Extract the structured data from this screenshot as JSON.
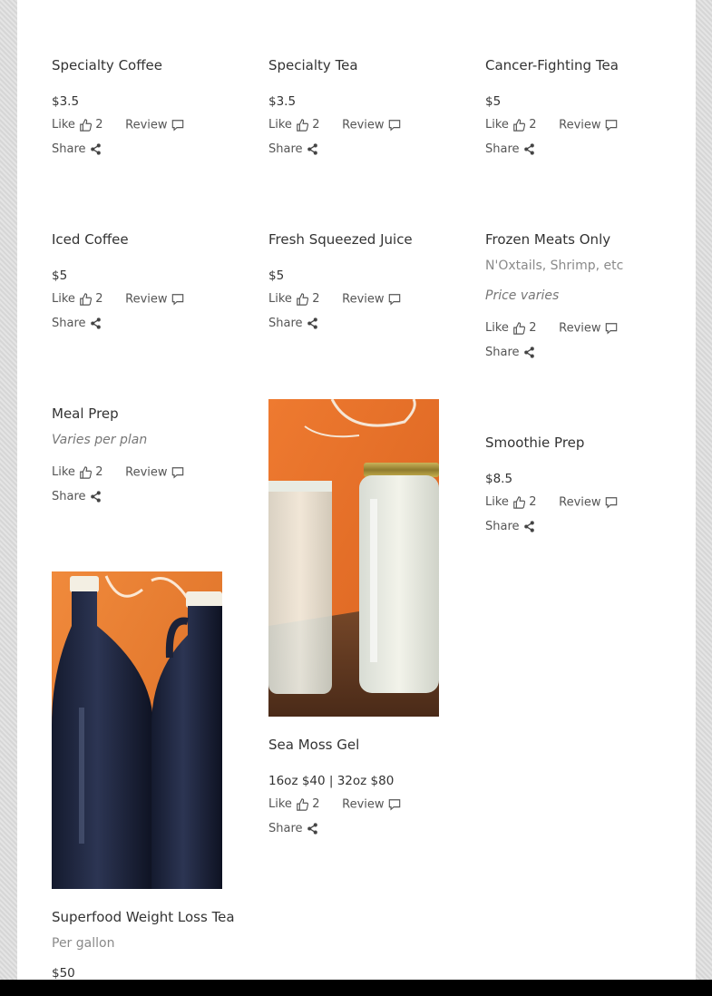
{
  "items": [
    {
      "title": "Specialty Coffee",
      "price": "$3.5",
      "like_label": "Like",
      "likes": "2",
      "review_label": "Review",
      "share_label": "Share"
    },
    {
      "title": "Specialty Tea",
      "price": "$3.5",
      "like_label": "Like",
      "likes": "2",
      "review_label": "Review",
      "share_label": "Share"
    },
    {
      "title": "Cancer-Fighting Tea",
      "price": "$5",
      "like_label": "Like",
      "likes": "2",
      "review_label": "Review",
      "share_label": "Share"
    },
    {
      "title": "Iced Coffee",
      "price": "$5",
      "like_label": "Like",
      "likes": "2",
      "review_label": "Review",
      "share_label": "Share"
    },
    {
      "title": "Fresh Squeezed Juice",
      "price": "$5",
      "like_label": "Like",
      "likes": "2",
      "review_label": "Review",
      "share_label": "Share"
    },
    {
      "title": "Frozen Meats Only",
      "description": "N'Oxtails, Shrimp, etc",
      "price": "Price varies",
      "like_label": "Like",
      "likes": "2",
      "review_label": "Review",
      "share_label": "Share"
    },
    {
      "title": "Meal Prep",
      "description": "Varies per plan",
      "like_label": "Like",
      "likes": "2",
      "review_label": "Review",
      "share_label": "Share"
    },
    {
      "title": "Sea Moss Gel",
      "price": "16oz $40 | 32oz $80",
      "like_label": "Like",
      "likes": "2",
      "review_label": "Review",
      "share_label": "Share"
    },
    {
      "title": "Smoothie Prep",
      "price": "$8.5",
      "like_label": "Like",
      "likes": "2",
      "review_label": "Review",
      "share_label": "Share"
    },
    {
      "title": "Superfood Weight Loss Tea",
      "description": "Per gallon",
      "price": "$50"
    }
  ],
  "colors": {
    "page_bg": "#dedede",
    "panel_bg": "#ffffff",
    "text": "#333333",
    "muted": "#8a8a8a",
    "jar_bg": "#e8732a"
  }
}
